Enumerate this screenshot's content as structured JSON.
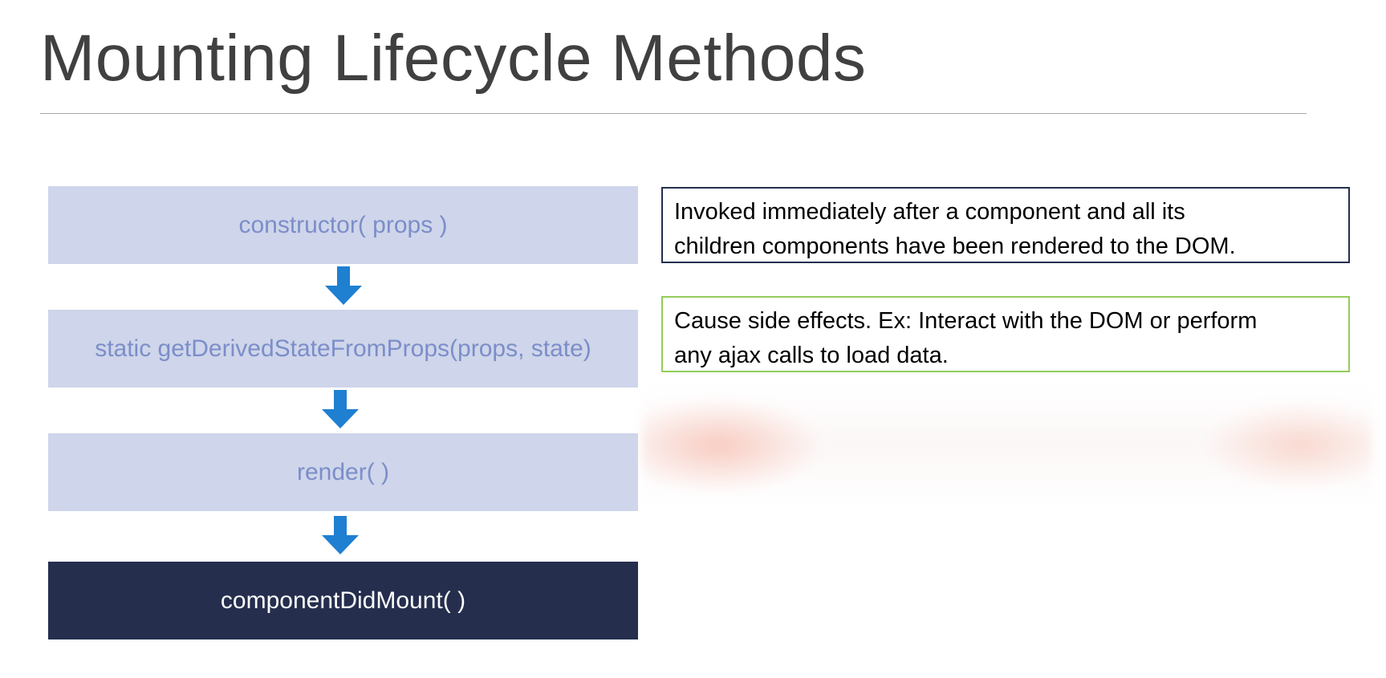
{
  "title": "Mounting Lifecycle Methods",
  "methods": [
    {
      "label": "constructor( props )"
    },
    {
      "label": "static getDerivedStateFromProps(props, state)"
    },
    {
      "label": "render( )"
    },
    {
      "label": "componentDidMount( )"
    }
  ],
  "notes": [
    {
      "line1": "Invoked immediately after a component and all its",
      "line2": "children components have been rendered to the DOM."
    },
    {
      "line1": "Cause side effects. Ex: Interact with the DOM or perform",
      "line2": "any ajax calls to load data."
    }
  ],
  "colors": {
    "light_box": "#cfd5ea",
    "light_text": "#7b8ec9",
    "dark_box": "#252e4d",
    "arrow": "#1f7fd1",
    "green_border": "#92cc5a"
  }
}
